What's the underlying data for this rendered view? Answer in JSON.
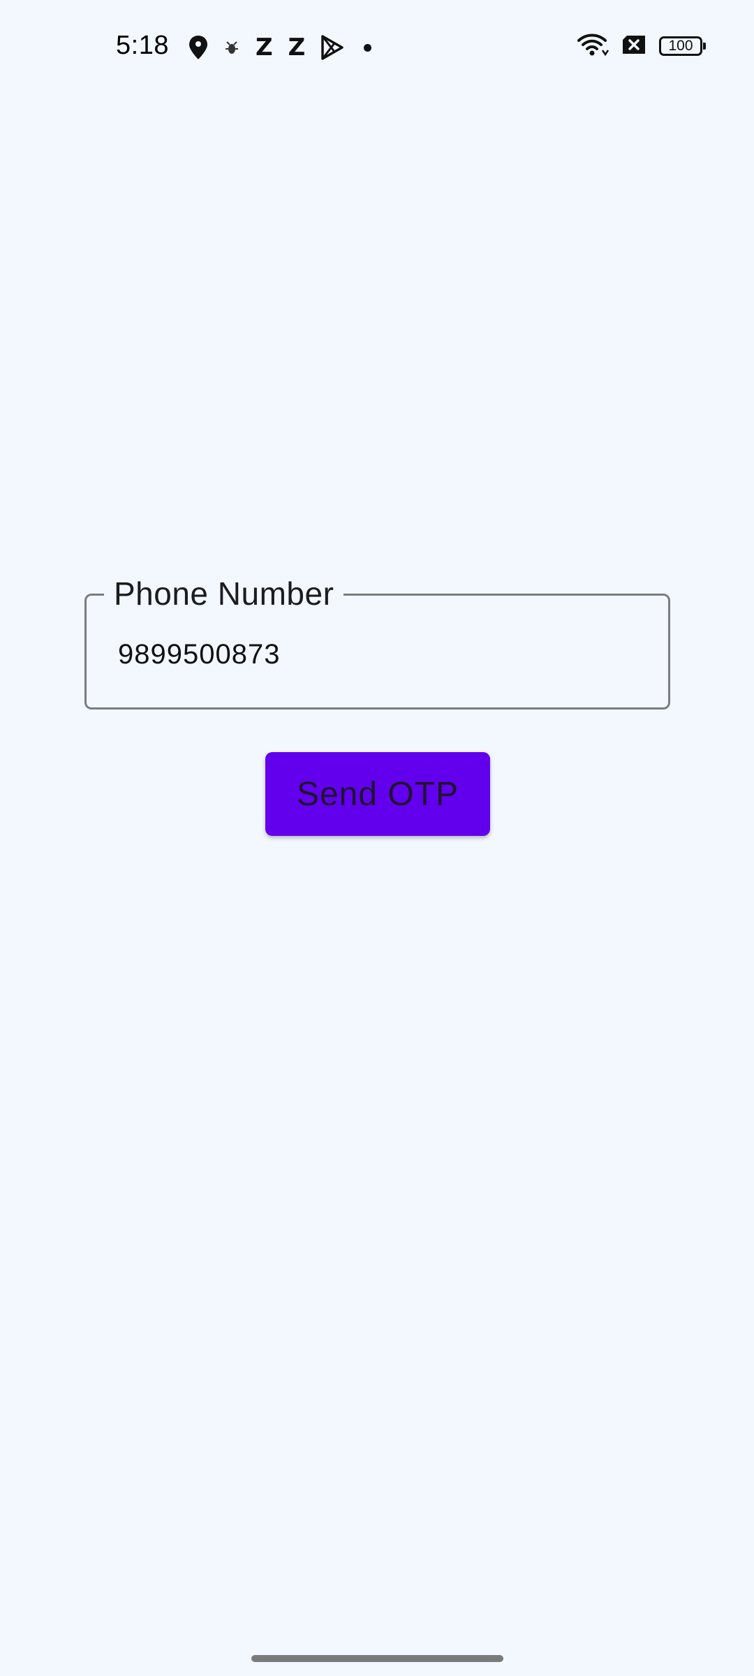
{
  "status_bar": {
    "time": "5:18",
    "notification_icons": [
      "location-pin-icon",
      "bug-icon",
      "z-icon",
      "z-icon",
      "play-store-icon",
      "dot-icon"
    ],
    "z_glyph": "Z",
    "battery_level": "100",
    "system_icons": [
      "wifi-icon",
      "no-sim-icon",
      "battery-icon"
    ]
  },
  "form": {
    "phone_label": "Phone Number",
    "phone_value": "9899500873",
    "send_button_label": "Send OTP"
  },
  "colors": {
    "background": "#f3f8fe",
    "button": "#6200ee",
    "field_border": "#7a7d80"
  }
}
